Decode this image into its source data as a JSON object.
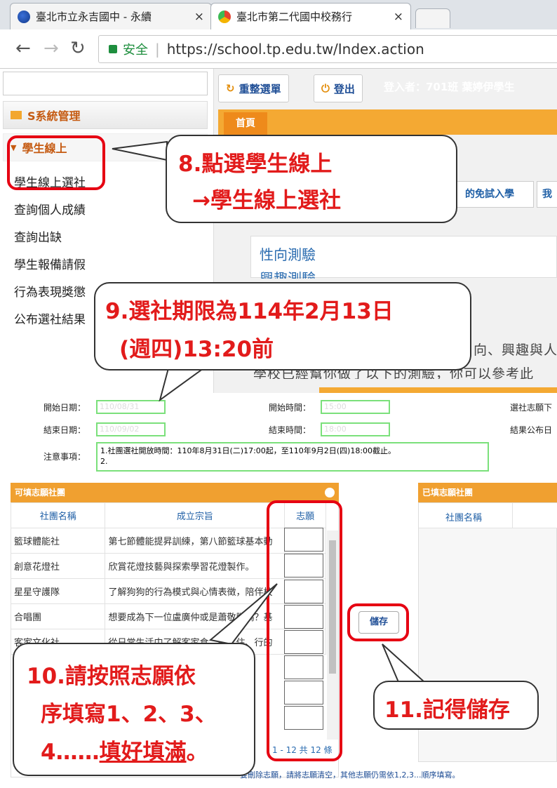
{
  "browser": {
    "tabs": [
      {
        "title": "臺北市立永吉國中 - 永續"
      },
      {
        "title": "臺北市第二代國中校務行"
      }
    ],
    "close_glyph": "×",
    "secure_label": "安全",
    "url": "https://school.tp.edu.tw/Index.action"
  },
  "sidebar": {
    "system_label": "S系統管理",
    "section_label": "學生線上",
    "items": [
      "學生線上選社",
      "查詢個人成績",
      "查詢出缺",
      "學生報備請假",
      "行為表現獎懲",
      "公布選社結果"
    ]
  },
  "main": {
    "reload_label": "重整選單",
    "logout_label": "登出",
    "user_label": "登入者：701班 葉婷伊學生",
    "home_tab": "首頁",
    "sub_tab": "的免試入學",
    "sub_tab2": "我",
    "heading1": "性向測驗",
    "heading2": "興趣測驗",
    "intro_line1": "向、興趣與人",
    "intro_line2": "學校已經幫你做了以下的測驗，你可以參考此"
  },
  "callouts": {
    "c8_line1": "8.點選學生線上",
    "c8_line2": "→學生線上選社",
    "c9_line1": "9.選社期限為114年2月13日",
    "c9_line2": "(週四)13:20前",
    "c10_line1": "10.請按照志願依",
    "c10_line2": "序填寫1、2、3、",
    "c10_line3a": "4……",
    "c10_line3b": "填好填滿",
    "c10_line3c": "。",
    "c11": "11.記得儲存"
  },
  "form": {
    "start_date_label": "開始日期：",
    "start_date_value": "110/08/31",
    "end_date_label": "結束日期：",
    "end_date_value": "110/09/02",
    "start_time_label": "開始時間：",
    "start_time_value": "15:00",
    "end_time_label": "結束時間：",
    "end_time_value": "18:00",
    "select_label": "選社志願下",
    "publish_label": "結果公布日",
    "notes_label": "注意事項：",
    "note1": "1.社團選社開放時間：110年8月31日(二)17:00起，至110年9月2日(四)18:00截止。",
    "note2": "2.",
    "left_panel_title": "可填志願社團",
    "right_panel_title": "已填志願社團",
    "col_name": "社團名稱",
    "col_purpose": "成立宗旨",
    "col_choice": "志願",
    "rows": [
      {
        "name": "籃球體能社",
        "purpose": "第七節體能提昇訓練，第八節籃球基本動"
      },
      {
        "name": "創意花燈社",
        "purpose": "欣賞花燈技藝與探索學習花燈製作。"
      },
      {
        "name": "星星守護隊",
        "purpose": "了解狗狗的行為模式與心情表徵，陪伴校"
      },
      {
        "name": "合唱團",
        "purpose": "想要成為下一位盧廣仲或是蕭敬騰嗎？基"
      },
      {
        "name": "客家文化社",
        "purpose": "從日常生活中了解客家食、衣、住、行的"
      }
    ],
    "save_label": "儲存",
    "pager": "1 - 12 共 12 條",
    "footer_note": "要刪除志願，請將志願清空，其他志願仍需依1,2,3...順序填寫。"
  }
}
